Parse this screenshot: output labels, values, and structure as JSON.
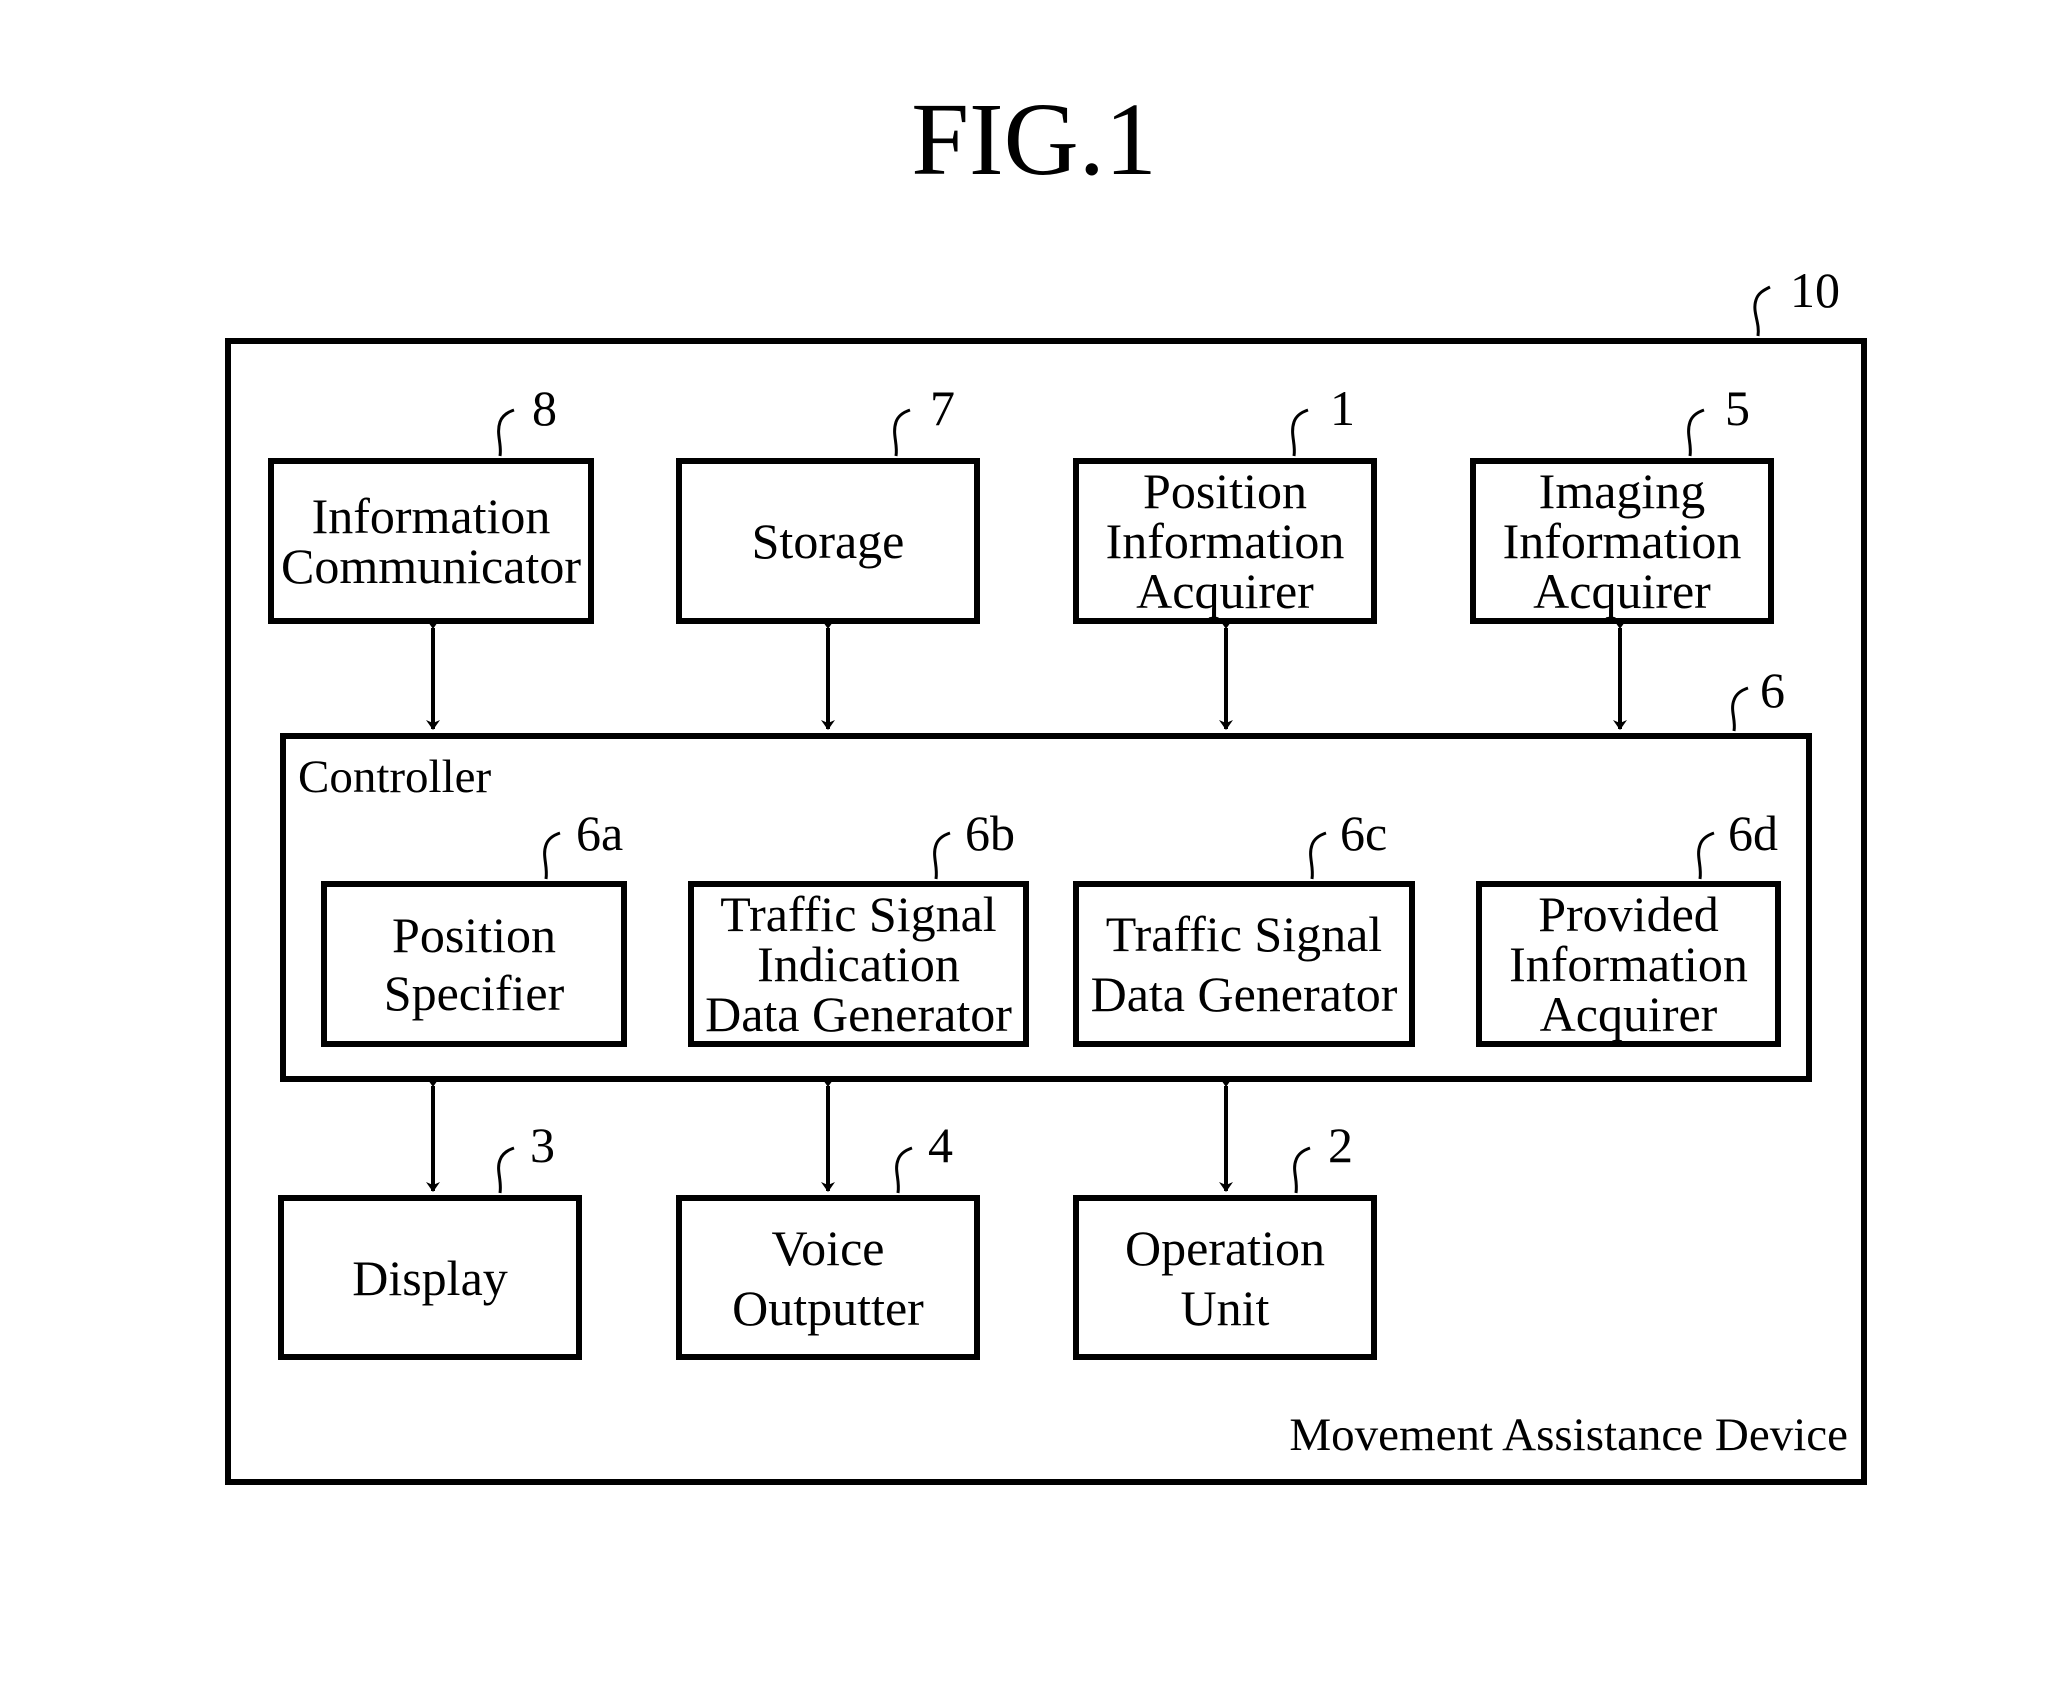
{
  "figure": {
    "title": "FIG.1",
    "device": {
      "ref": "10",
      "label": "Movement Assistance Device"
    },
    "controller": {
      "ref": "6",
      "label": "Controller"
    },
    "top_blocks": [
      {
        "ref": "8",
        "label": "Information\nCommunicator"
      },
      {
        "ref": "7",
        "label": "Storage"
      },
      {
        "ref": "1",
        "label": "Position\nInformation\nAcquirer"
      },
      {
        "ref": "5",
        "label": "Imaging\nInformation\nAcquirer"
      }
    ],
    "controller_blocks": [
      {
        "ref": "6a",
        "label": "Position\nSpecifier"
      },
      {
        "ref": "6b",
        "label": "Traffic Signal\nIndication\nData Generator"
      },
      {
        "ref": "6c",
        "label": "Traffic Signal\nData Generator"
      },
      {
        "ref": "6d",
        "label": "Provided\nInformation\nAcquirer"
      }
    ],
    "bottom_blocks": [
      {
        "ref": "3",
        "label": "Display"
      },
      {
        "ref": "4",
        "label": "Voice\nOutputter"
      },
      {
        "ref": "2",
        "label": "Operation\nUnit"
      }
    ],
    "connections": [
      {
        "from": "8",
        "to": "6",
        "type": "bidirectional"
      },
      {
        "from": "7",
        "to": "6",
        "type": "bidirectional"
      },
      {
        "from": "1",
        "to": "6",
        "type": "bidirectional"
      },
      {
        "from": "5",
        "to": "6",
        "type": "bidirectional"
      },
      {
        "from": "6",
        "to": "3",
        "type": "bidirectional"
      },
      {
        "from": "6",
        "to": "4",
        "type": "bidirectional"
      },
      {
        "from": "6",
        "to": "2",
        "type": "bidirectional"
      }
    ]
  }
}
